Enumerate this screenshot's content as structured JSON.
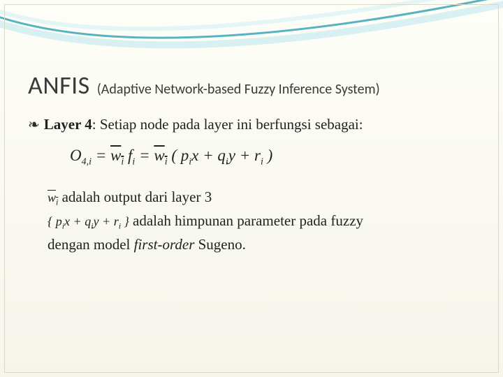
{
  "title": {
    "main": "ANFIS",
    "sub": "(Adaptive Network-based Fuzzy Inference System)"
  },
  "bullet": {
    "layer_label": "Layer 4",
    "layer_text": ": Setiap node pada layer ini berfungsi sebagai:"
  },
  "formula": {
    "lhs_O": "O",
    "lhs_sub": "4,i",
    "eq": " = ",
    "w": "w",
    "i": "i",
    "f": "f",
    "open": " ( ",
    "p": "p",
    "x": "x",
    "plus": " + ",
    "q": "q",
    "y": "y",
    "r": "r",
    "close": " )"
  },
  "desc": {
    "wi_text": " adalah output dari layer 3",
    "set_open": "{ ",
    "set_close": " }",
    "set_text": " adalah himpunan parameter pada fuzzy",
    "line3a": "dengan model ",
    "line3_italic": "first-order",
    "line3b": " Sugeno."
  }
}
